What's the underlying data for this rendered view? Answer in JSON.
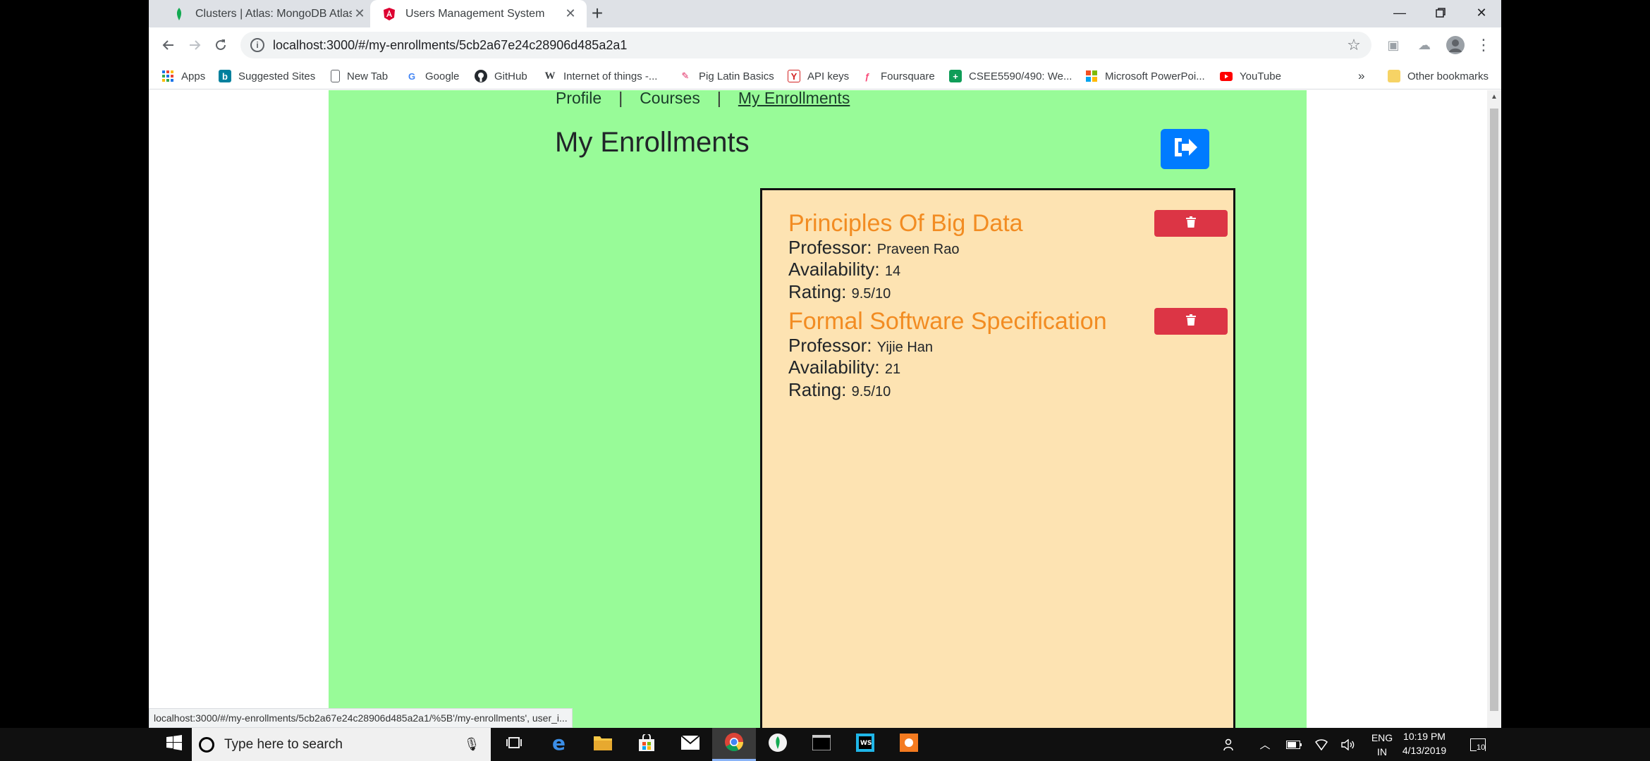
{
  "browser": {
    "tabs": [
      {
        "title": "Clusters | Atlas: MongoDB Atlas",
        "active": false
      },
      {
        "title": "Users Management System",
        "active": true
      }
    ],
    "url": "localhost:3000/#/my-enrollments/5cb2a67e24c28906d485a2a1",
    "bookmarks": [
      "Apps",
      "Suggested Sites",
      "New Tab",
      "Google",
      "GitHub",
      "Internet of things -...",
      "Pig Latin Basics",
      "API keys",
      "Foursquare",
      "CSEE5590/490: We...",
      "Microsoft PowerPoi...",
      "YouTube"
    ],
    "overflow_chevron": "»",
    "other_bookmarks": "Other bookmarks",
    "status_url": "localhost:3000/#/my-enrollments/5cb2a67e24c28906d485a2a1/%5B'/my-enrollments', user_i..."
  },
  "page": {
    "nav": {
      "profile": "Profile",
      "sep": "|",
      "courses": "Courses",
      "enrollments": "My Enrollments"
    },
    "title": "My Enrollments",
    "labels": {
      "professor": "Professor:",
      "availability": "Availability:",
      "rating": "Rating:"
    },
    "enrollments": [
      {
        "name": "Principles Of Big Data",
        "professor": "Praveen Rao",
        "availability": "14",
        "rating": "9.5/10"
      },
      {
        "name": "Formal Software Specification",
        "professor": "Yijie Han",
        "availability": "21",
        "rating": "9.5/10"
      }
    ]
  },
  "taskbar": {
    "search_placeholder": "Type here to search",
    "lang_line1": "ENG",
    "lang_line2": "IN",
    "time": "10:19 PM",
    "date": "4/13/2019",
    "notifications": "10"
  },
  "colors": {
    "page_bg": "#98fb98",
    "card_bg": "#fde3b2",
    "course_title": "#f28c22",
    "logout_btn": "#007bff",
    "delete_btn": "#dc3545"
  }
}
